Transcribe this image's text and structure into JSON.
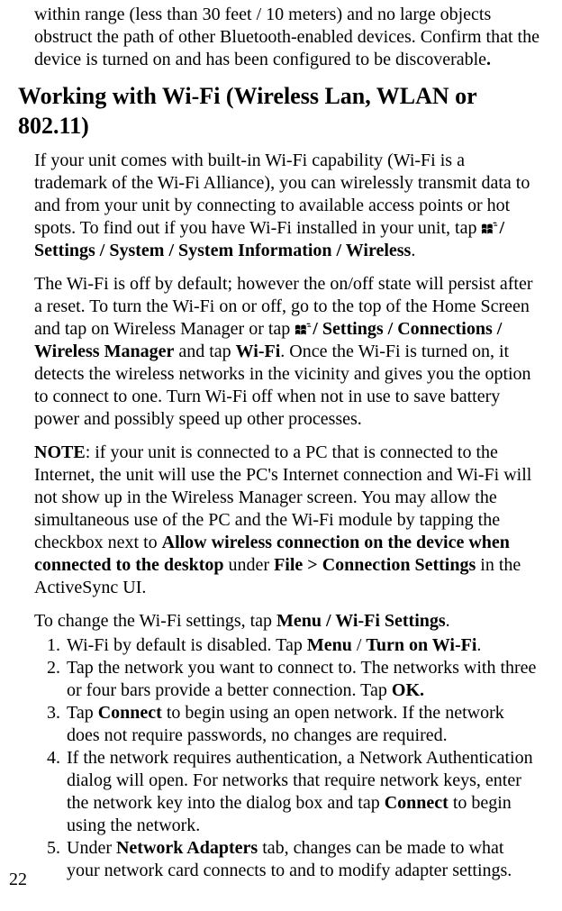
{
  "intro_para": "within range (less than 30 feet / 10 meters) and no large objects obstruct the path of other Bluetooth-enabled devices. Confirm that the device is turned on and has been configured to be discoverable",
  "intro_end": ".",
  "heading": "Working with Wi-Fi (Wireless Lan, WLAN or 802.11)",
  "wifi_intro": "If your unit comes with built-in Wi-Fi capability (Wi-Fi is a trademark of the Wi-Fi Alliance), you can wirelessly transmit data to and from your unit by connecting to available access points or hot spots. To find out if you have Wi-Fi installed in your unit, tap ",
  "settings_path": "/ Settings / System / System Information / Wireless",
  "wifi_off_pre": "The Wi-Fi is off by default; however the on/off state will persist after a reset. To turn the Wi-Fi on or off, go to the top of the Home Screen and tap on Wireless Manager or tap  ",
  "settings_conn": "/ Settings / Connections / Wireless Manager",
  "and_tap": " and tap ",
  "wifi": "Wi-Fi",
  "wifi_off_post": ". Once the Wi-Fi is turned on, it detects the wireless networks in the vicinity and gives you the option to connect to one. Turn Wi-Fi off when not in use to save battery power and possibly speed up other processes.",
  "note_label": "NOTE",
  "note_pre": ": if your unit is connected to a PC that is connected to the Internet, the unit will use the PC's Internet connection and Wi-Fi will not show up in the Wireless Manager screen. You may allow the simultaneous use of the PC and the Wi-Fi module by tapping the checkbox next to ",
  "allow_wireless": "Allow wireless connection on the device when connected to the desktop",
  "under": " under ",
  "file_conn": "File > Connection Settings",
  "note_end": " in the ActiveSync UI.",
  "change_intro": "To change the Wi-Fi settings, tap ",
  "menu_wifi": "Menu / Wi-Fi Settings",
  "change_end": ".",
  "li1_pre": "Wi-Fi by default is disabled. Tap ",
  "li1_menu": "Menu",
  "li1_slash": " / ",
  "li1_turn": "Turn on Wi-Fi",
  "li1_end": ".",
  "li2_pre": "Tap the network you want to connect to. The networks with three or four bars provide a better connection. Tap ",
  "li2_ok": "OK.",
  "li3_pre": "Tap ",
  "li3_connect": "Connect",
  "li3_post": " to begin using an open network. If the network does not require passwords, no changes are required.",
  "li4_pre": "If the network requires authentication, a Network Authentication dialog will open. For networks that require network keys, enter the network key into the dialog box and tap ",
  "li4_connect": "Connect",
  "li4_post": " to begin using the network.",
  "li5_pre": "Under ",
  "li5_na": "Network Adapters",
  "li5_post": " tab, changes can be made to what your network card connects to and to modify adapter settings.",
  "page_number": "22"
}
